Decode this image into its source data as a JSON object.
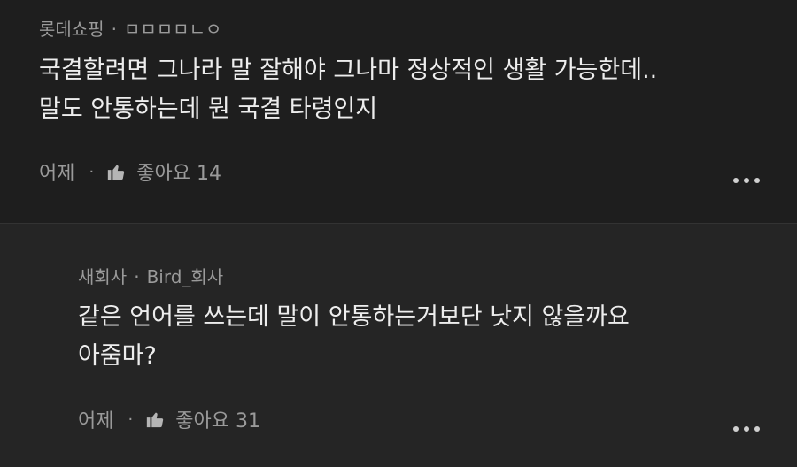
{
  "comments": [
    {
      "author": "롯데쇼핑",
      "handle": "ㅁㅁㅁㅁㄴㅇ",
      "lines": [
        "국결할려면 그나라 말 잘해야 그나마 정상적인 생활 가능한데..",
        "말도 안통하는데 뭔 국결 타령인지"
      ],
      "time": "어제",
      "like_label": "좋아요",
      "like_count": "14"
    },
    {
      "author": "새회사",
      "handle": "Bird_회사",
      "lines": [
        "같은 언어를 쓰는데 말이 안통하는거보단 낫지 않을까요",
        "아줌마?"
      ],
      "time": "어제",
      "like_label": "좋아요",
      "like_count": "31"
    }
  ],
  "separator": "·",
  "icons": {
    "like": "thumbs-up-icon",
    "more": "more-options-icon"
  }
}
